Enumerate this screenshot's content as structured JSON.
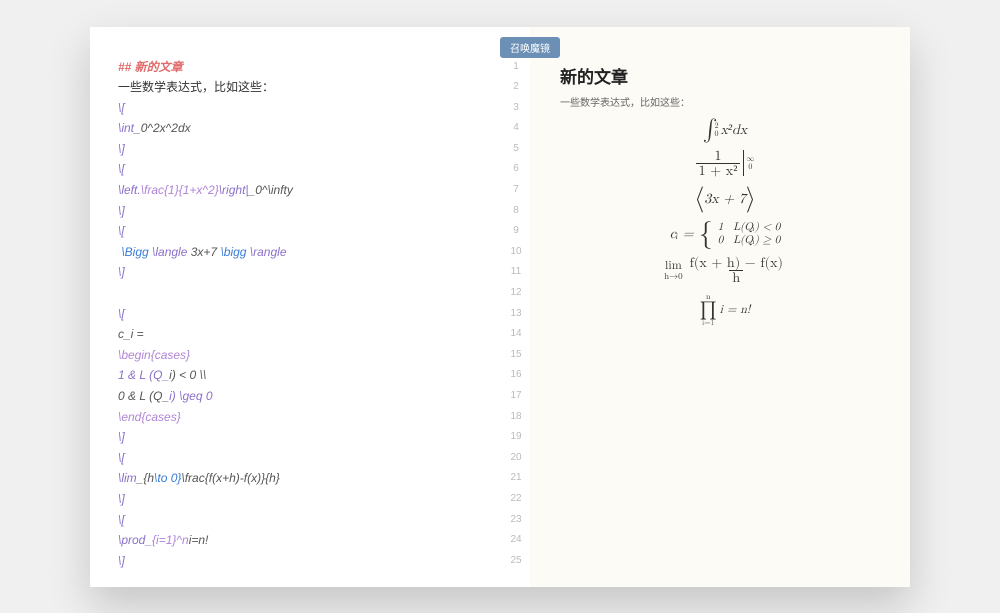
{
  "midButton": {
    "label": "召唤魔镜"
  },
  "editor": {
    "lineCount": 25,
    "lines": [
      {
        "frags": [
          {
            "t": "## 新的文章",
            "cls": "c-red"
          }
        ]
      },
      {
        "frags": [
          {
            "t": "一些数学表达式，比如这些：",
            "cls": "c-text"
          }
        ]
      },
      {
        "frags": [
          {
            "t": "\\[",
            "cls": "c-key"
          }
        ]
      },
      {
        "frags": [
          {
            "t": "\\int",
            "cls": "c-key"
          },
          {
            "t": "_0^2x^2dx",
            "cls": "c-plain"
          }
        ]
      },
      {
        "frags": [
          {
            "t": "\\]",
            "cls": "c-key"
          }
        ]
      },
      {
        "frags": [
          {
            "t": "\\[",
            "cls": "c-key"
          }
        ]
      },
      {
        "frags": [
          {
            "t": "\\left.",
            "cls": "c-key"
          },
          {
            "t": "\\frac{1}{1+x^2}",
            "cls": "c-brace"
          },
          {
            "t": "\\right|",
            "cls": "c-key"
          },
          {
            "t": "_0^\\infty",
            "cls": "c-plain"
          }
        ]
      },
      {
        "frags": [
          {
            "t": "\\]",
            "cls": "c-key"
          }
        ]
      },
      {
        "frags": [
          {
            "t": "\\[",
            "cls": "c-key"
          }
        ]
      },
      {
        "frags": [
          {
            "t": " \\Bigg ",
            "cls": "c-cmd"
          },
          {
            "t": "\\langle",
            "cls": "c-key"
          },
          {
            "t": " 3x+7 ",
            "cls": "c-plain"
          },
          {
            "t": "\\bigg ",
            "cls": "c-cmd"
          },
          {
            "t": "\\rangle",
            "cls": "c-key"
          }
        ]
      },
      {
        "frags": [
          {
            "t": "\\]",
            "cls": "c-key"
          }
        ]
      },
      {
        "frags": []
      },
      {
        "frags": [
          {
            "t": "\\[",
            "cls": "c-key"
          }
        ]
      },
      {
        "frags": [
          {
            "t": "c_i =",
            "cls": "c-plain"
          }
        ]
      },
      {
        "frags": [
          {
            "t": "\\begin{cases}",
            "cls": "c-brace"
          }
        ]
      },
      {
        "frags": [
          {
            "t": "1 & L (Q_",
            "cls": "c-key"
          },
          {
            "t": "i",
            "cls": "c-plain"
          },
          {
            "t": ") < 0 \\\\",
            "cls": "c-plain"
          }
        ]
      },
      {
        "frags": [
          {
            "t": "0 & L (Q_",
            "cls": "c-plain"
          },
          {
            "t": "i) \\geq 0",
            "cls": "c-key"
          }
        ]
      },
      {
        "frags": [
          {
            "t": "\\end{cases}",
            "cls": "c-brace"
          }
        ]
      },
      {
        "frags": [
          {
            "t": "\\]",
            "cls": "c-key"
          }
        ]
      },
      {
        "frags": [
          {
            "t": "\\[",
            "cls": "c-key"
          }
        ]
      },
      {
        "frags": [
          {
            "t": "\\lim",
            "cls": "c-key"
          },
          {
            "t": "_{h",
            "cls": "c-plain"
          },
          {
            "t": "\\to 0}",
            "cls": "c-cmd"
          },
          {
            "t": "\\frac{f(x+h)-f(x)}{h}",
            "cls": "c-plain"
          }
        ]
      },
      {
        "frags": [
          {
            "t": "\\]",
            "cls": "c-key"
          }
        ]
      },
      {
        "frags": [
          {
            "t": "\\[",
            "cls": "c-key"
          }
        ]
      },
      {
        "frags": [
          {
            "t": "\\prod_",
            "cls": "c-key"
          },
          {
            "t": "{i=1}^n",
            "cls": "c-brace"
          },
          {
            "t": "i=n!",
            "cls": "c-plain"
          }
        ]
      },
      {
        "frags": [
          {
            "t": "\\]",
            "cls": "c-key"
          }
        ]
      }
    ]
  },
  "preview": {
    "title": "新的文章",
    "subtitle": "一些数学表达式，比如这些：",
    "integral": {
      "sup": "2",
      "sub": "0",
      "body": "x²dx"
    },
    "fracBar": {
      "num": "1",
      "den": "1 + x²",
      "sup": "∞",
      "sub": "0"
    },
    "angle": {
      "body": "3x + 7"
    },
    "cases": {
      "lhs": "cᵢ =",
      "r1a": "1",
      "r1b": "L(Qᵢ) < 0",
      "r2a": "0",
      "r2b": "L(Qᵢ) ≥ 0"
    },
    "limit": {
      "top": "lim",
      "bot": "h→0",
      "num": "f(x + h) − f(x)",
      "den": "h"
    },
    "product": {
      "sup": "n",
      "sub": "i=1",
      "rhs": "i = n!"
    }
  }
}
